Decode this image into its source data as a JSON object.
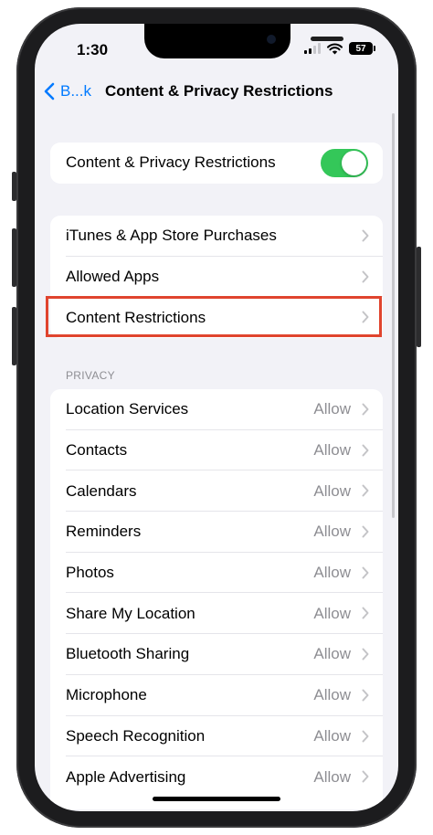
{
  "status_bar": {
    "time": "1:30",
    "battery": "57"
  },
  "nav": {
    "back_label": "B...k",
    "title": "Content & Privacy Restrictions"
  },
  "master_toggle": {
    "label": "Content & Privacy Restrictions",
    "on": true
  },
  "store_group": [
    {
      "label": "iTunes & App Store Purchases"
    },
    {
      "label": "Allowed Apps"
    },
    {
      "label": "Content Restrictions",
      "highlighted": true
    }
  ],
  "privacy": {
    "header": "PRIVACY",
    "items": [
      {
        "label": "Location Services",
        "value": "Allow"
      },
      {
        "label": "Contacts",
        "value": "Allow"
      },
      {
        "label": "Calendars",
        "value": "Allow"
      },
      {
        "label": "Reminders",
        "value": "Allow"
      },
      {
        "label": "Photos",
        "value": "Allow"
      },
      {
        "label": "Share My Location",
        "value": "Allow"
      },
      {
        "label": "Bluetooth Sharing",
        "value": "Allow"
      },
      {
        "label": "Microphone",
        "value": "Allow"
      },
      {
        "label": "Speech Recognition",
        "value": "Allow"
      },
      {
        "label": "Apple Advertising",
        "value": "Allow"
      }
    ]
  },
  "colors": {
    "accent": "#007aff",
    "toggle_on": "#34c759",
    "highlight": "#e0442e"
  }
}
